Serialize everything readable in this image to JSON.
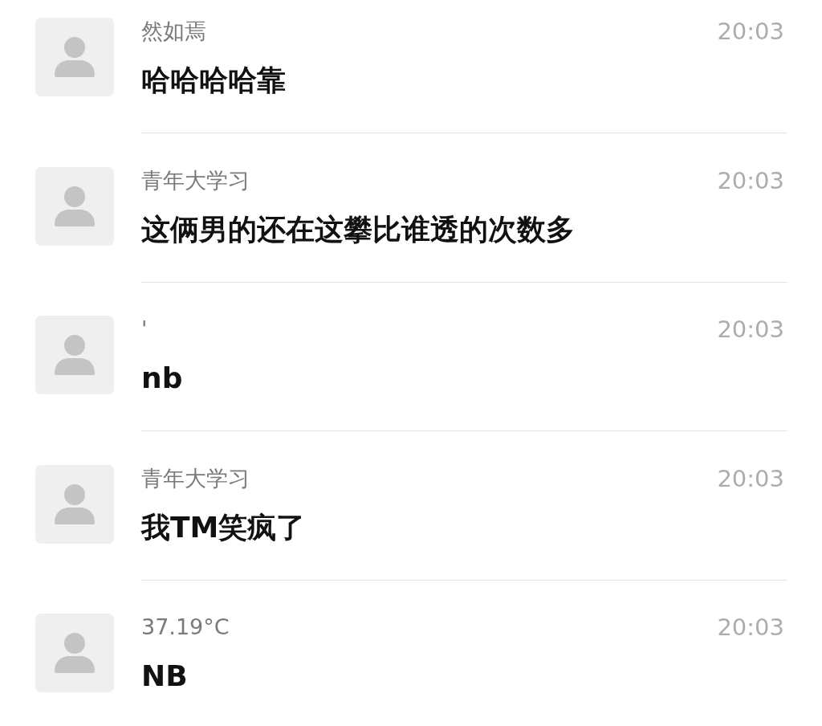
{
  "messages": [
    {
      "name": "然如焉",
      "text": "哈哈哈哈靠",
      "time": "20:03"
    },
    {
      "name": "青年大学习",
      "text": "这俩男的还在这攀比谁透的次数多",
      "time": "20:03"
    },
    {
      "name": "'",
      "text": "nb",
      "time": "20:03"
    },
    {
      "name": "青年大学习",
      "text": "我TM笑疯了",
      "time": "20:03"
    },
    {
      "name": "37.19°C",
      "text": "NB",
      "time": "20:03"
    }
  ]
}
